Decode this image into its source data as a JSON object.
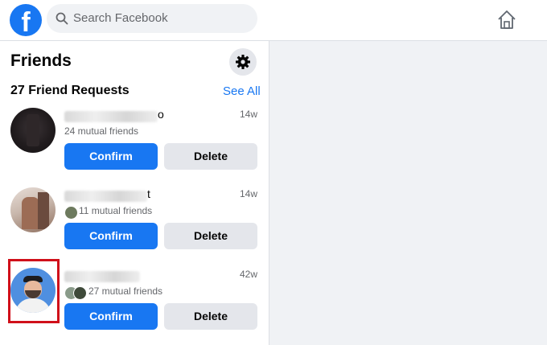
{
  "header": {
    "logo_letter": "f",
    "search_placeholder": "Search Facebook"
  },
  "sidebar": {
    "title": "Friends",
    "request_count_label": "27 Friend Requests",
    "see_all": "See All"
  },
  "requests": [
    {
      "name_visible_tail": "o",
      "time": "14w",
      "mutual": "24 mutual friends",
      "confirm": "Confirm",
      "delete": "Delete"
    },
    {
      "name_visible_tail": "t",
      "time": "14w",
      "mutual": "11 mutual friends",
      "confirm": "Confirm",
      "delete": "Delete"
    },
    {
      "name_visible_tail": "",
      "time": "42w",
      "mutual": "27 mutual friends",
      "confirm": "Confirm",
      "delete": "Delete"
    }
  ],
  "colors": {
    "brand": "#1877f2",
    "highlight": "#d0101a"
  }
}
